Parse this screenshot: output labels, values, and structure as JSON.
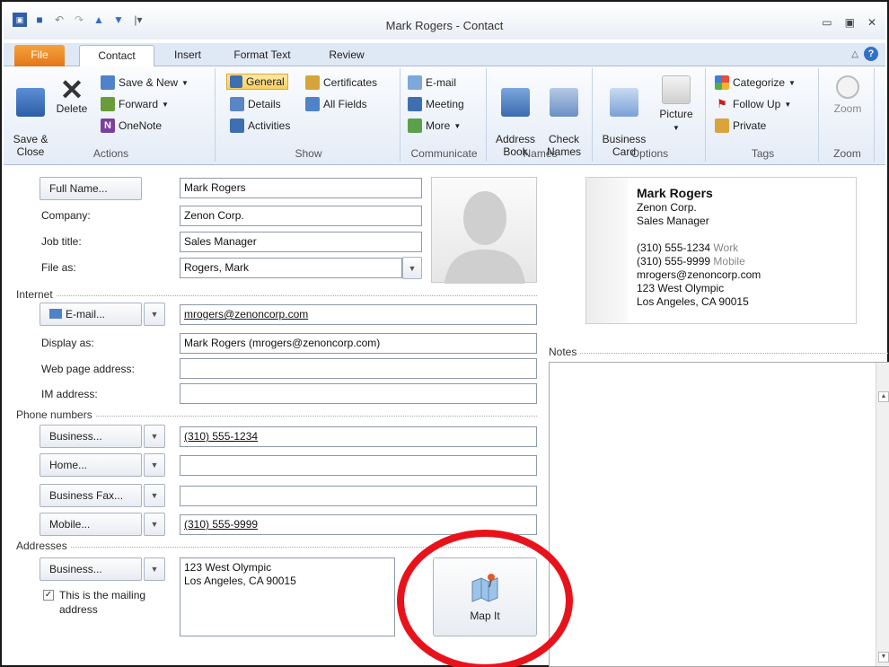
{
  "window": {
    "title": "Mark Rogers  -  Contact",
    "controls": [
      "▭",
      "▣",
      "✕"
    ]
  },
  "tabs": {
    "file": "File",
    "contact": "Contact",
    "insert": "Insert",
    "format_text": "Format Text",
    "review": "Review"
  },
  "ribbon": {
    "actions": {
      "label": "Actions",
      "save_close": "Save &\nClose",
      "delete": "Delete",
      "save_new": "Save & New",
      "forward": "Forward",
      "onenote": "OneNote"
    },
    "show": {
      "label": "Show",
      "general": "General",
      "details": "Details",
      "activities": "Activities",
      "certificates": "Certificates",
      "all_fields": "All Fields"
    },
    "communicate": {
      "label": "Communicate",
      "email": "E-mail",
      "meeting": "Meeting",
      "more": "More"
    },
    "names": {
      "label": "Names",
      "address_book": "Address\nBook",
      "check_names": "Check\nNames"
    },
    "options": {
      "label": "Options",
      "business_card": "Business\nCard",
      "picture": "Picture"
    },
    "tags": {
      "label": "Tags",
      "categorize": "Categorize",
      "follow_up": "Follow Up",
      "private": "Private"
    },
    "zoom": {
      "label": "Zoom",
      "zoom": "Zoom"
    }
  },
  "form": {
    "full_name_button": "Full Name...",
    "full_name": "Mark Rogers",
    "company_label": "Company:",
    "company": "Zenon Corp.",
    "job_title_label": "Job title:",
    "job_title": "Sales Manager",
    "file_as_label": "File as:",
    "file_as": "Rogers, Mark",
    "internet_section": "Internet",
    "email_button": "E-mail...",
    "email": "mrogers@zenoncorp.com",
    "display_as_label": "Display as:",
    "display_as": "Mark Rogers (mrogers@zenoncorp.com)",
    "web_label": "Web page address:",
    "web": "",
    "im_label": "IM address:",
    "im": "",
    "phone_section": "Phone numbers",
    "phones": [
      {
        "button": "Business...",
        "value": "(310) 555-1234"
      },
      {
        "button": "Home...",
        "value": ""
      },
      {
        "button": "Business Fax...",
        "value": ""
      },
      {
        "button": "Mobile...",
        "value": "(310) 555-9999"
      }
    ],
    "addresses_section": "Addresses",
    "address_button": "Business...",
    "address_line1": "123 West Olympic",
    "address_line2": "Los Angeles, CA 90015",
    "mailing_checkbox_line1": "This is the mailing",
    "mailing_checkbox_line2": "address",
    "map_it": "Map It",
    "notes_label": "Notes"
  },
  "card": {
    "name": "Mark Rogers",
    "company": "Zenon Corp.",
    "title": "Sales Manager",
    "work_phone": "(310) 555-1234",
    "work_label": "Work",
    "mobile_phone": "(310) 555-9999",
    "mobile_label": "Mobile",
    "email": "mrogers@zenoncorp.com",
    "address_line1": "123 West Olympic",
    "address_line2": "Los Angeles, CA 90015"
  },
  "colors": {
    "annotation_circle": "#e8121b",
    "file_tab": "#e3761a",
    "selected_button": "#f9cf5c"
  }
}
